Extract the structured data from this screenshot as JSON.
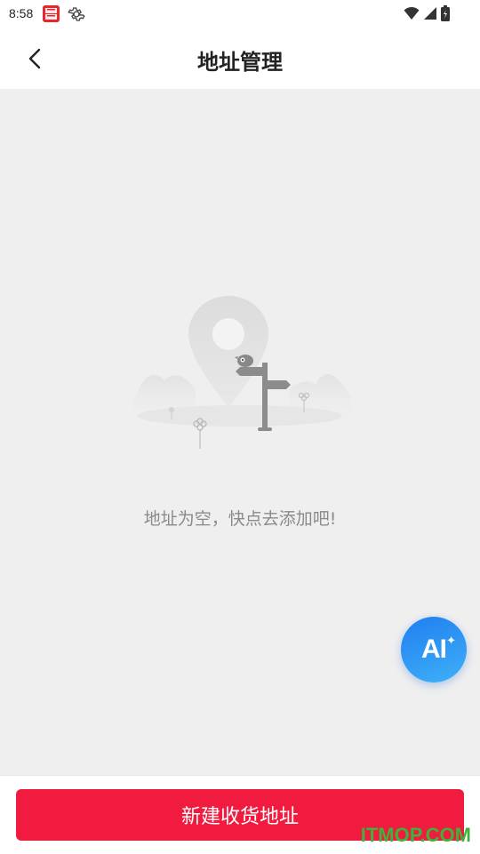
{
  "status_bar": {
    "time": "8:58",
    "icons": [
      "app-icon",
      "gear-icon",
      "wifi-icon",
      "signal-icon",
      "battery-icon"
    ]
  },
  "header": {
    "title": "地址管理",
    "back_icon": "chevron-left-icon"
  },
  "empty_state": {
    "message": "地址为空，快点去添加吧!",
    "illustration": "location-pin-signpost-illustration"
  },
  "ai_button": {
    "label": "AI",
    "spark": "✦"
  },
  "footer": {
    "button_label": "新建收货地址"
  },
  "watermark": "ITMOP.COM",
  "colors": {
    "primary": "#f01b3e",
    "ai_gradient_start": "#1f7ff0",
    "ai_gradient_end": "#3fb0f8",
    "background": "#efefef"
  }
}
